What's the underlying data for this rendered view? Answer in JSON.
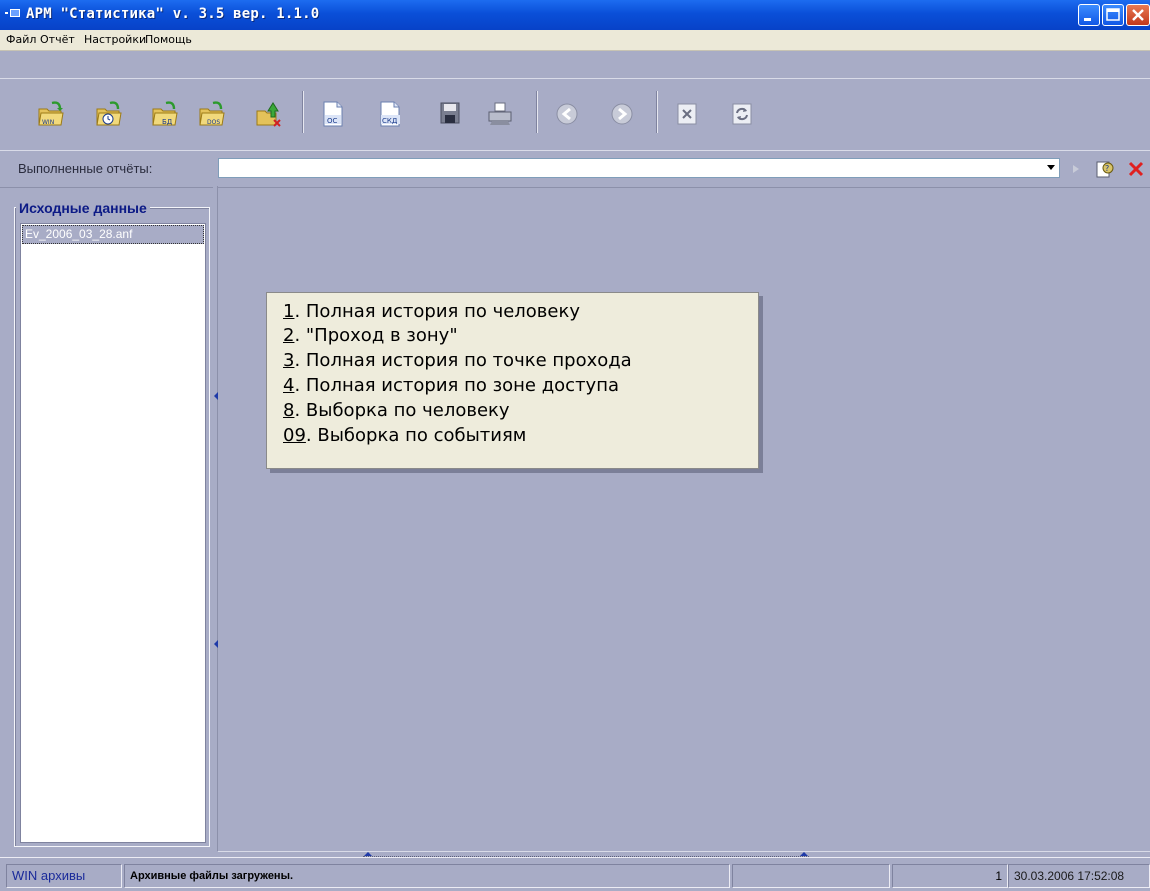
{
  "window": {
    "title": "АРМ \"Статистика\"  v. 3.5  вер. 1.1.0"
  },
  "menu": {
    "items": [
      "Файл",
      "Отчёт",
      "Настройки",
      "Помощь"
    ]
  },
  "toolbar": {
    "buttons": [
      {
        "icon": "folder-win-icon",
        "label": "WIN"
      },
      {
        "icon": "folder-clock-icon",
        "label": ""
      },
      {
        "icon": "folder-bd-icon",
        "label": "БД"
      },
      {
        "icon": "folder-dos-icon",
        "label": "DOS"
      },
      {
        "icon": "folder-up-delete-icon",
        "label": ""
      },
      {
        "icon": "doc-oc-icon",
        "label": "ОС"
      },
      {
        "icon": "doc-ska-icon",
        "label": "СКД"
      },
      {
        "icon": "save-icon",
        "label": ""
      },
      {
        "icon": "print-icon",
        "label": ""
      },
      {
        "icon": "back-icon",
        "label": ""
      },
      {
        "icon": "forward-icon",
        "label": ""
      },
      {
        "icon": "delete-doc-icon",
        "label": ""
      },
      {
        "icon": "refresh-doc-icon",
        "label": ""
      }
    ]
  },
  "reports": {
    "label": "Выполненные отчёты:",
    "selected": ""
  },
  "source": {
    "title": "Исходные данные",
    "files": [
      "Ev_2006_03_28.anf"
    ]
  },
  "popup_menu": {
    "items": [
      {
        "key": "1",
        "text": ". Полная история по человеку"
      },
      {
        "key": "2",
        "text": ". \"Проход в зону\""
      },
      {
        "key": "3",
        "text": ". Полная история по точке прохода"
      },
      {
        "key": "4",
        "text": ". Полная история по зоне доступа"
      },
      {
        "key": "8",
        "text": ". Выборка по человеку"
      },
      {
        "key": "09",
        "text": ". Выборка по событиям"
      }
    ]
  },
  "status": {
    "mode": "WIN архивы",
    "message": "Архивные файлы загружены.",
    "count": "1",
    "datetime": "30.03.2006 17:52:08"
  },
  "colors": {
    "background": "#a8acc6",
    "title_bar": "#0a4fd8",
    "panel_title": "#0c1a86"
  }
}
